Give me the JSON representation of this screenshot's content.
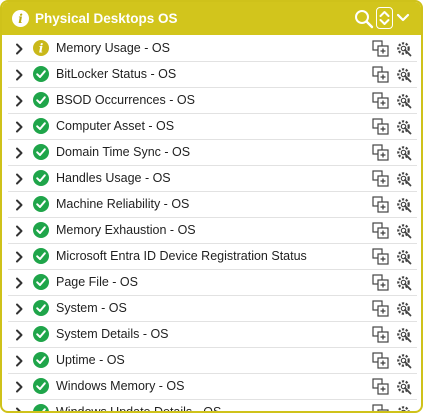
{
  "header": {
    "title": "Physical Desktops OS",
    "accent_color": "#d2c51c",
    "icons": [
      "info-icon",
      "search-icon",
      "sort-icon",
      "collapse-icon"
    ]
  },
  "colors": {
    "ok": "#1fa54a",
    "warning": "#c9b81a"
  },
  "rows": [
    {
      "label": "Memory Usage - OS",
      "status": "warning"
    },
    {
      "label": "BitLocker Status - OS",
      "status": "ok"
    },
    {
      "label": "BSOD Occurrences - OS",
      "status": "ok"
    },
    {
      "label": "Computer Asset - OS",
      "status": "ok"
    },
    {
      "label": "Domain Time Sync - OS",
      "status": "ok"
    },
    {
      "label": "Handles Usage - OS",
      "status": "ok"
    },
    {
      "label": "Machine Reliability - OS",
      "status": "ok"
    },
    {
      "label": "Memory Exhaustion - OS",
      "status": "ok"
    },
    {
      "label": "Microsoft Entra ID Device Registration Status",
      "status": "ok"
    },
    {
      "label": "Page File - OS",
      "status": "ok"
    },
    {
      "label": "System - OS",
      "status": "ok"
    },
    {
      "label": "System Details - OS",
      "status": "ok"
    },
    {
      "label": "Uptime - OS",
      "status": "ok"
    },
    {
      "label": "Windows Memory - OS",
      "status": "ok"
    },
    {
      "label": "Windows Update Details - OS",
      "status": "ok"
    }
  ]
}
